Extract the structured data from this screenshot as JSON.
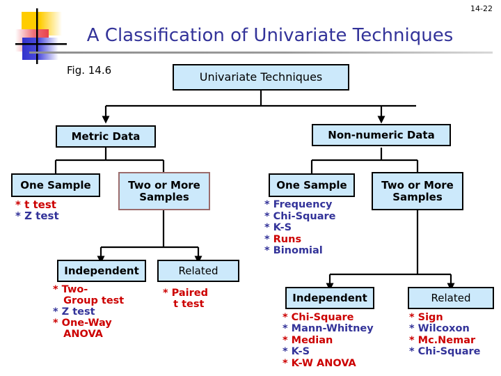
{
  "slide": {
    "number": "14-22",
    "title": "A Classification of Univariate Techniques",
    "figure_label": "Fig. 14.6"
  },
  "colors": {
    "title": "#333399",
    "node_fill": "#cce9fb",
    "node_border": "#000000",
    "node_border_alt": "#9b6b6b",
    "accent_red": "#cc0000",
    "accent_navy": "#333399"
  },
  "chart_data": {
    "type": "diagram",
    "title": "A Classification of Univariate Techniques",
    "nodes": [
      {
        "id": "root",
        "label": "Univariate Techniques"
      },
      {
        "id": "metric",
        "label": "Metric Data"
      },
      {
        "id": "nonnumeric",
        "label": "Non-numeric Data"
      },
      {
        "id": "m-one",
        "label": "One Sample"
      },
      {
        "id": "m-two",
        "label": "Two or More\nSamples"
      },
      {
        "id": "n-one",
        "label": "One Sample"
      },
      {
        "id": "n-two",
        "label": "Two or More\nSamples"
      },
      {
        "id": "m-indep",
        "label": "Independent"
      },
      {
        "id": "m-rel",
        "label": "Related"
      },
      {
        "id": "n-indep",
        "label": "Independent"
      },
      {
        "id": "n-rel",
        "label": "Related"
      }
    ],
    "edges": [
      [
        "root",
        "metric"
      ],
      [
        "root",
        "nonnumeric"
      ],
      [
        "metric",
        "m-one"
      ],
      [
        "metric",
        "m-two"
      ],
      [
        "nonnumeric",
        "n-one"
      ],
      [
        "nonnumeric",
        "n-two"
      ],
      [
        "m-two",
        "m-indep"
      ],
      [
        "m-two",
        "m-rel"
      ],
      [
        "n-two",
        "n-indep"
      ],
      [
        "n-two",
        "n-rel"
      ]
    ]
  },
  "nodes": {
    "root": {
      "label": "Univariate Techniques"
    },
    "metric": {
      "label": "Metric Data"
    },
    "nonnumeric": {
      "label": "Non-numeric Data"
    },
    "metric_one": {
      "label": "One Sample"
    },
    "metric_two_line1": {
      "label": "Two or More"
    },
    "metric_two_line2": {
      "label": "Samples"
    },
    "nonnum_one": {
      "label": "One Sample"
    },
    "nonnum_two_line1": {
      "label": "Two or More"
    },
    "nonnum_two_line2": {
      "label": "Samples"
    },
    "metric_independent": {
      "label": "Independent"
    },
    "metric_related": {
      "label": "Related"
    },
    "nonnum_independent": {
      "label": "Independent"
    },
    "nonnum_related": {
      "label": "Related"
    }
  },
  "lists": {
    "metric_one_sample": {
      "items": [
        {
          "marker": "*",
          "text": "t test",
          "color": "red"
        },
        {
          "marker": "*",
          "text": "Z test",
          "color": "navy"
        }
      ],
      "l1m": "*",
      "l1t": " t test",
      "l2m": "*",
      "l2t": " Z test"
    },
    "metric_independent": {
      "items": [
        {
          "marker": "*",
          "text": "Two-",
          "color": "red"
        },
        {
          "marker": "",
          "text": "Group test",
          "color": "red"
        },
        {
          "marker": "*",
          "text": "Z test",
          "color": "navy"
        },
        {
          "marker": "*",
          "text": "One-Way",
          "color": "red"
        },
        {
          "marker": "",
          "text": "ANOVA",
          "color": "red"
        }
      ],
      "l1m": "*",
      "l1t": " Two-",
      "l2m": "",
      "l2t": "   Group test",
      "l3m": "*",
      "l3t": " Z test",
      "l4m": "*",
      "l4t": " One-Way",
      "l5m": "",
      "l5t": "   ANOVA"
    },
    "metric_related": {
      "items": [
        {
          "marker": "*",
          "text": "Paired",
          "color": "red"
        },
        {
          "marker": "",
          "text": "t test",
          "color": "red"
        }
      ],
      "l1m": "*",
      "l1t": " Paired",
      "l2m": "",
      "l2t": "   t test"
    },
    "nonnum_one_sample": {
      "items": [
        {
          "marker": "*",
          "text": "Frequency",
          "color": "navy"
        },
        {
          "marker": "*",
          "text": "Chi-Square",
          "color": "navy"
        },
        {
          "marker": "*",
          "text": "K-S",
          "color": "navy"
        },
        {
          "marker": "*",
          "text": "Runs",
          "color": "red"
        },
        {
          "marker": "*",
          "text": "Binomial",
          "color": "navy"
        }
      ],
      "l1m": "*",
      "l1t": " Frequency",
      "l2m": "*",
      "l2t": " Chi-Square",
      "l3m": "*",
      "l3t": " K-S",
      "l4m": "*",
      "l4t": " Runs",
      "l5m": "*",
      "l5t": " Binomial"
    },
    "nonnum_independent": {
      "items": [
        {
          "marker": "*",
          "text": "Chi-Square",
          "color": "red"
        },
        {
          "marker": "*",
          "text": "Mann-Whitney",
          "color": "navy"
        },
        {
          "marker": "*",
          "text": "Median",
          "color": "red"
        },
        {
          "marker": "*",
          "text": "K-S",
          "color": "navy"
        },
        {
          "marker": "*",
          "text": "K-W ANOVA",
          "color": "red"
        }
      ],
      "l1m": "*",
      "l1t": " Chi-Square",
      "l2m": "*",
      "l2t": " Mann-Whitney",
      "l3m": "*",
      "l3t": " Median",
      "l4m": "*",
      "l4t": " K-S",
      "l5m": "*",
      "l5t": " K-W ANOVA"
    },
    "nonnum_related": {
      "items": [
        {
          "marker": "*",
          "text": "Sign",
          "color": "red"
        },
        {
          "marker": "*",
          "text": "Wilcoxon",
          "color": "navy"
        },
        {
          "marker": "*",
          "text": "Mc.Nemar",
          "color": "red"
        },
        {
          "marker": "*",
          "text": "Chi-Square",
          "color": "navy"
        }
      ],
      "l1m": "*",
      "l1t": " Sign",
      "l2m": "*",
      "l2t": " Wilcoxon",
      "l3m": "*",
      "l3t": " Mc.Nemar",
      "l4m": "*",
      "l4t": " Chi-Square"
    }
  }
}
